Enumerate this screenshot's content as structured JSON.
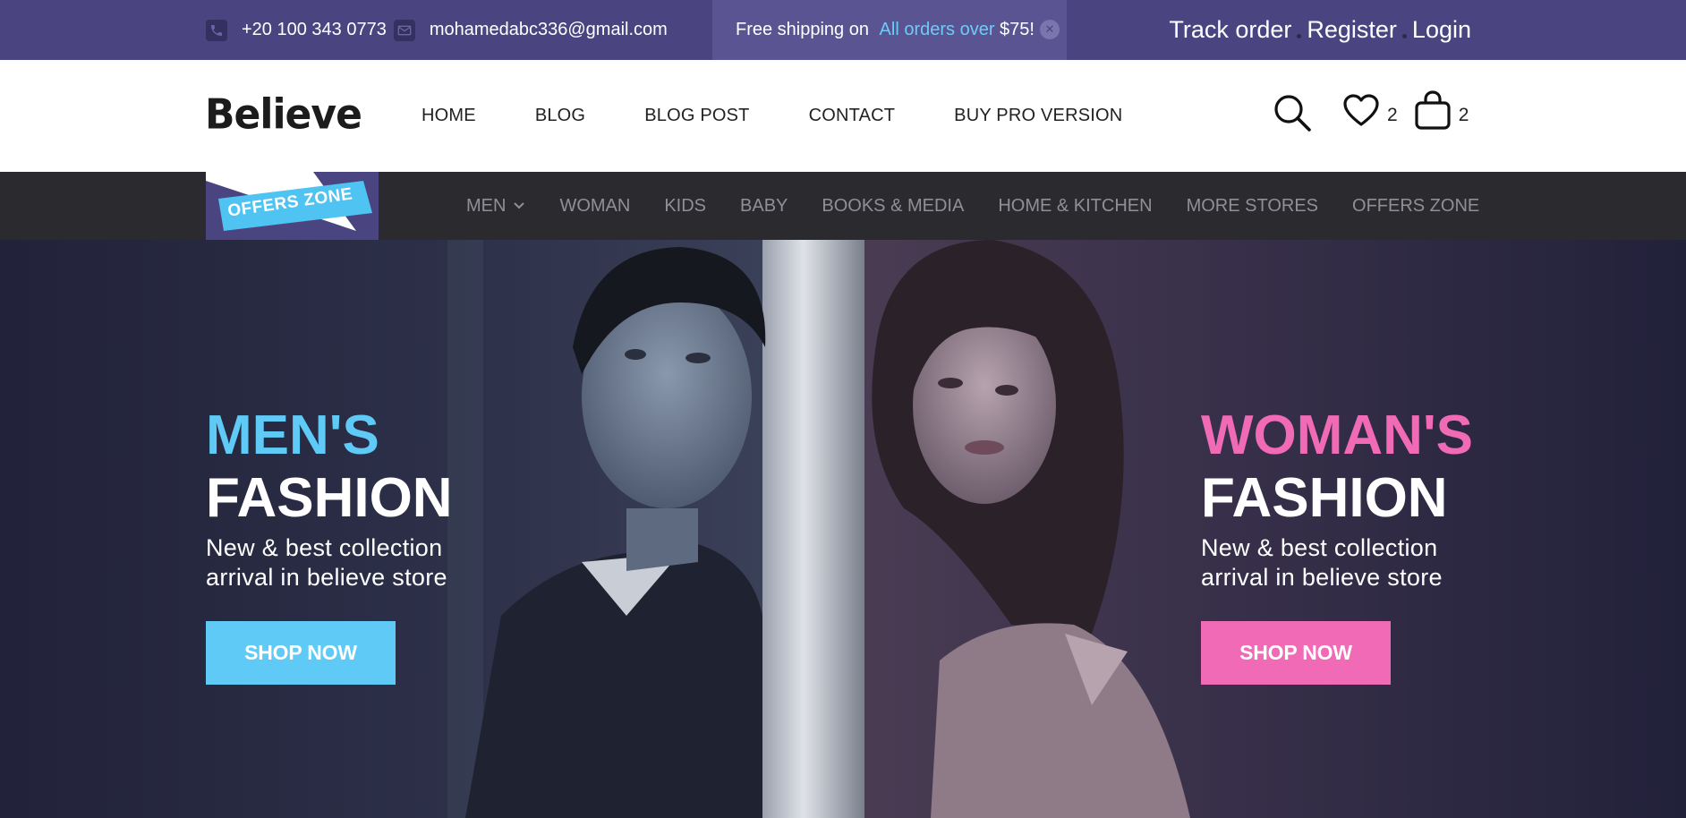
{
  "topbar": {
    "phone": "+20 100 343 0773",
    "email": "mohamedabc336@gmail.com",
    "promo": {
      "prefix": "Free shipping on ",
      "highlight": "All orders over",
      "suffix": " $75!"
    },
    "account_links": [
      "Track order",
      "Register",
      "Login"
    ]
  },
  "header": {
    "logo": "Believe",
    "nav": [
      "HOME",
      "BLOG",
      "BLOG POST",
      "CONTACT",
      "BUY PRO VERSION"
    ],
    "wishlist_count": "2",
    "cart_count": "2"
  },
  "catnav": {
    "badge": "OFFERS ZONE",
    "items": [
      "MEN",
      "WOMAN",
      "KIDS",
      "BABY",
      "BOOKS & MEDIA",
      "HOME & KITCHEN",
      "MORE STORES",
      "OFFERS ZONE"
    ]
  },
  "hero": {
    "men": {
      "line1": "MEN'S",
      "line2": "FASHION",
      "sub1": "New & best collection",
      "sub2": "arrival in believe store",
      "cta": "SHOP NOW"
    },
    "women": {
      "line1": "WOMAN'S",
      "line2": "FASHION",
      "sub1": "New & best collection",
      "sub2": "arrival in believe store",
      "cta": "SHOP NOW"
    }
  },
  "colors": {
    "topbar": "#4a4580",
    "accent_blue": "#5fcaf5",
    "accent_pink": "#f06ab5",
    "catbar": "#2b2b2f",
    "hero_bg": "#26253b"
  },
  "icons": [
    "phone-icon",
    "mail-icon",
    "close-icon",
    "search-icon",
    "heart-icon",
    "bag-icon",
    "chevron-down-icon"
  ]
}
